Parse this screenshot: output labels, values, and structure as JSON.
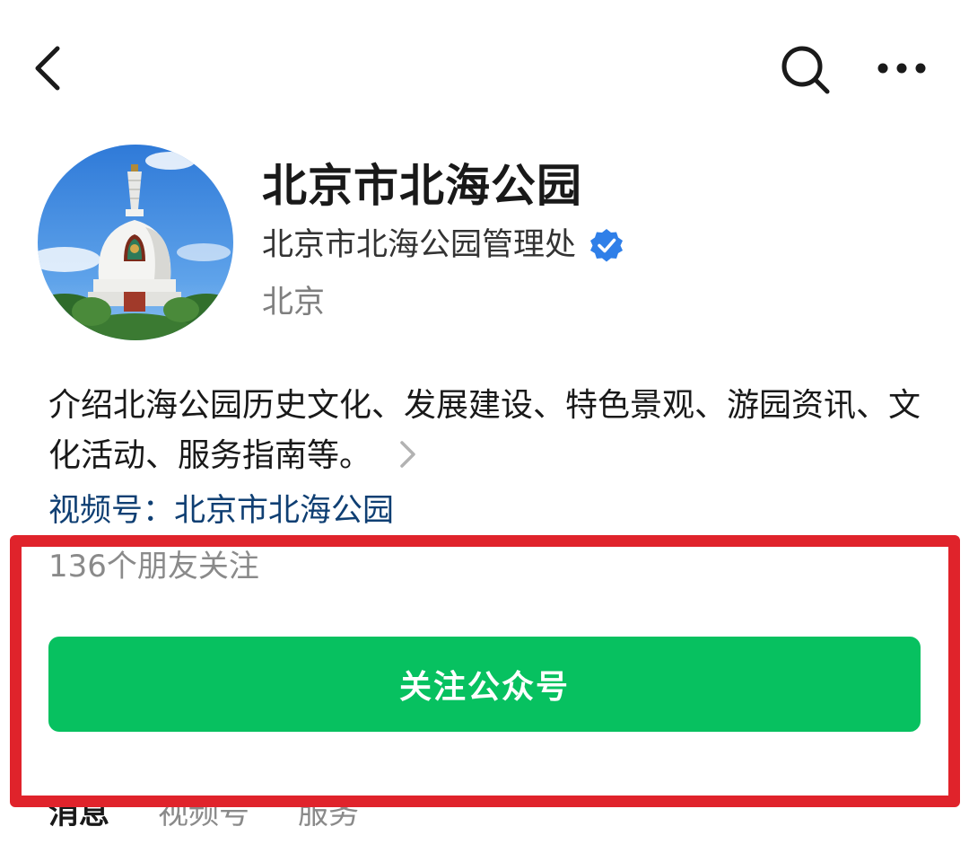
{
  "header": {
    "back_icon": "chevron-left-icon",
    "search_icon": "search-icon",
    "more_icon": "more-horizontal-icon"
  },
  "profile": {
    "avatar": "white-dagoba-avatar",
    "name": "北京市北海公园",
    "organization": "北京市北海公园管理处",
    "verified_icon": "verified-badge-icon",
    "verified_color": "#2f7fe8",
    "location": "北京"
  },
  "intro": {
    "text": "介绍北海公园历史文化、发展建设、特色景观、游园资讯、文化活动、服务指南等。",
    "chevron_icon": "chevron-right-icon"
  },
  "channel": {
    "label": "视频号：北京市北海公园"
  },
  "friends": {
    "text": "136个朋友关注"
  },
  "follow_button": {
    "label": "关注公众号",
    "color": "#07c160"
  },
  "tabs": [
    {
      "label": "消息"
    },
    {
      "label": "视频号"
    },
    {
      "label": "服务"
    }
  ],
  "highlight_color": "#e0232b"
}
